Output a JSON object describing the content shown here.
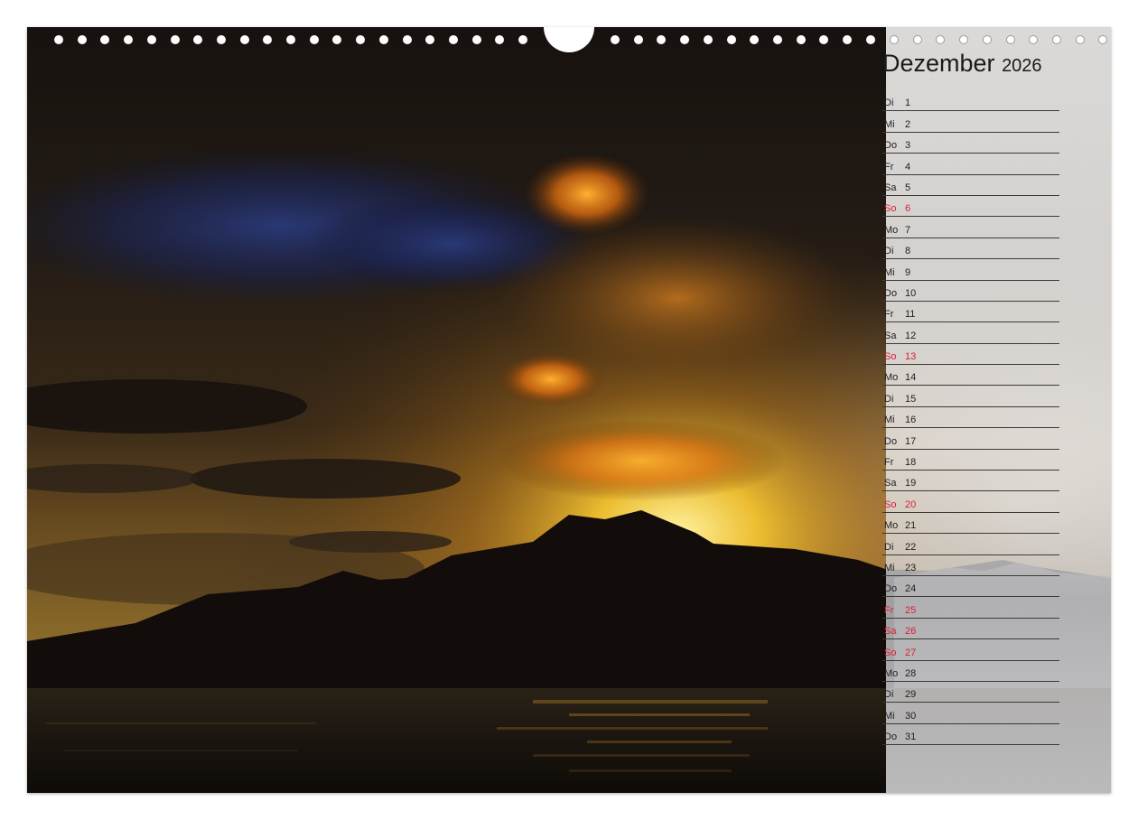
{
  "calendar": {
    "month": "Dezember",
    "year": "2026",
    "days": [
      {
        "name": "Di",
        "date": "1",
        "holiday": false
      },
      {
        "name": "Mi",
        "date": "2",
        "holiday": false
      },
      {
        "name": "Do",
        "date": "3",
        "holiday": false
      },
      {
        "name": "Fr",
        "date": "4",
        "holiday": false
      },
      {
        "name": "Sa",
        "date": "5",
        "holiday": false
      },
      {
        "name": "So",
        "date": "6",
        "holiday": true
      },
      {
        "name": "Mo",
        "date": "7",
        "holiday": false
      },
      {
        "name": "Di",
        "date": "8",
        "holiday": false
      },
      {
        "name": "Mi",
        "date": "9",
        "holiday": false
      },
      {
        "name": "Do",
        "date": "10",
        "holiday": false
      },
      {
        "name": "Fr",
        "date": "11",
        "holiday": false
      },
      {
        "name": "Sa",
        "date": "12",
        "holiday": false
      },
      {
        "name": "So",
        "date": "13",
        "holiday": true
      },
      {
        "name": "Mo",
        "date": "14",
        "holiday": false
      },
      {
        "name": "Di",
        "date": "15",
        "holiday": false
      },
      {
        "name": "Mi",
        "date": "16",
        "holiday": false
      },
      {
        "name": "Do",
        "date": "17",
        "holiday": false
      },
      {
        "name": "Fr",
        "date": "18",
        "holiday": false
      },
      {
        "name": "Sa",
        "date": "19",
        "holiday": false
      },
      {
        "name": "So",
        "date": "20",
        "holiday": true
      },
      {
        "name": "Mo",
        "date": "21",
        "holiday": false
      },
      {
        "name": "Di",
        "date": "22",
        "holiday": false
      },
      {
        "name": "Mi",
        "date": "23",
        "holiday": false
      },
      {
        "name": "Do",
        "date": "24",
        "holiday": false
      },
      {
        "name": "Fr",
        "date": "25",
        "holiday": true
      },
      {
        "name": "Sa",
        "date": "26",
        "holiday": true
      },
      {
        "name": "So",
        "date": "27",
        "holiday": true
      },
      {
        "name": "Mo",
        "date": "28",
        "holiday": false
      },
      {
        "name": "Di",
        "date": "29",
        "holiday": false
      },
      {
        "name": "Mi",
        "date": "30",
        "holiday": false
      },
      {
        "name": "Do",
        "date": "31",
        "holiday": false
      }
    ]
  },
  "colors": {
    "holiday_text": "#d8203a",
    "regular_text": "#222222",
    "panel_background": "#ebe9e7"
  },
  "icons": {
    "binding_holes": "spiral-binding-holes",
    "hanger": "hanger-cutout"
  }
}
